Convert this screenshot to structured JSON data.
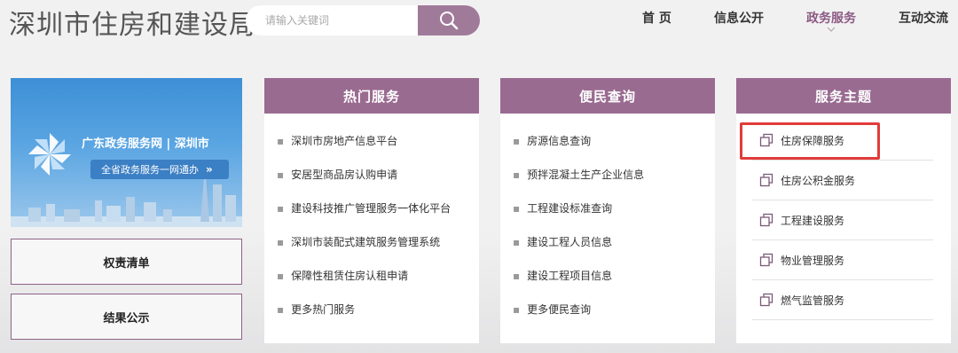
{
  "header": {
    "site_title": "深圳市住房和建设局",
    "search_placeholder": "请输入关键词"
  },
  "nav": {
    "items": [
      "首 页",
      "信息公开",
      "政务服务",
      "互动交流"
    ],
    "active": "政务服务"
  },
  "banner": {
    "title": "广东政务服务网 | 深圳市",
    "pill": "全省政务服务一网通办",
    "pill_arrows": "»"
  },
  "side_buttons": [
    "权责清单",
    "结果公示"
  ],
  "hot_services": {
    "title": "热门服务",
    "items": [
      "深圳市房地产信息平台",
      "安居型商品房认购申请",
      "建设科技推广管理服务一体化平台",
      "深圳市装配式建筑服务管理系统",
      "保障性租赁住房认租申请",
      "更多热门服务"
    ]
  },
  "public_query": {
    "title": "便民查询",
    "items": [
      "房源信息查询",
      "预拌混凝土生产企业信息",
      "工程建设标准查询",
      "建设工程人员信息",
      "建设工程项目信息",
      "更多便民查询"
    ]
  },
  "service_themes": {
    "title": "服务主题",
    "items": [
      "住房保障服务",
      "住房公积金服务",
      "工程建设服务",
      "物业管理服务",
      "燃气监管服务"
    ],
    "highlighted": "住房保障服务"
  },
  "colors": {
    "accent": "#9a6b91",
    "nav_active": "#8c5a84",
    "highlight": "#e23b3b",
    "banner_blue": "#3d8fd6"
  },
  "icons": {
    "search": "magnifier-icon",
    "theme_item": "copy-pages-icon",
    "bullet": "square-bullet"
  }
}
